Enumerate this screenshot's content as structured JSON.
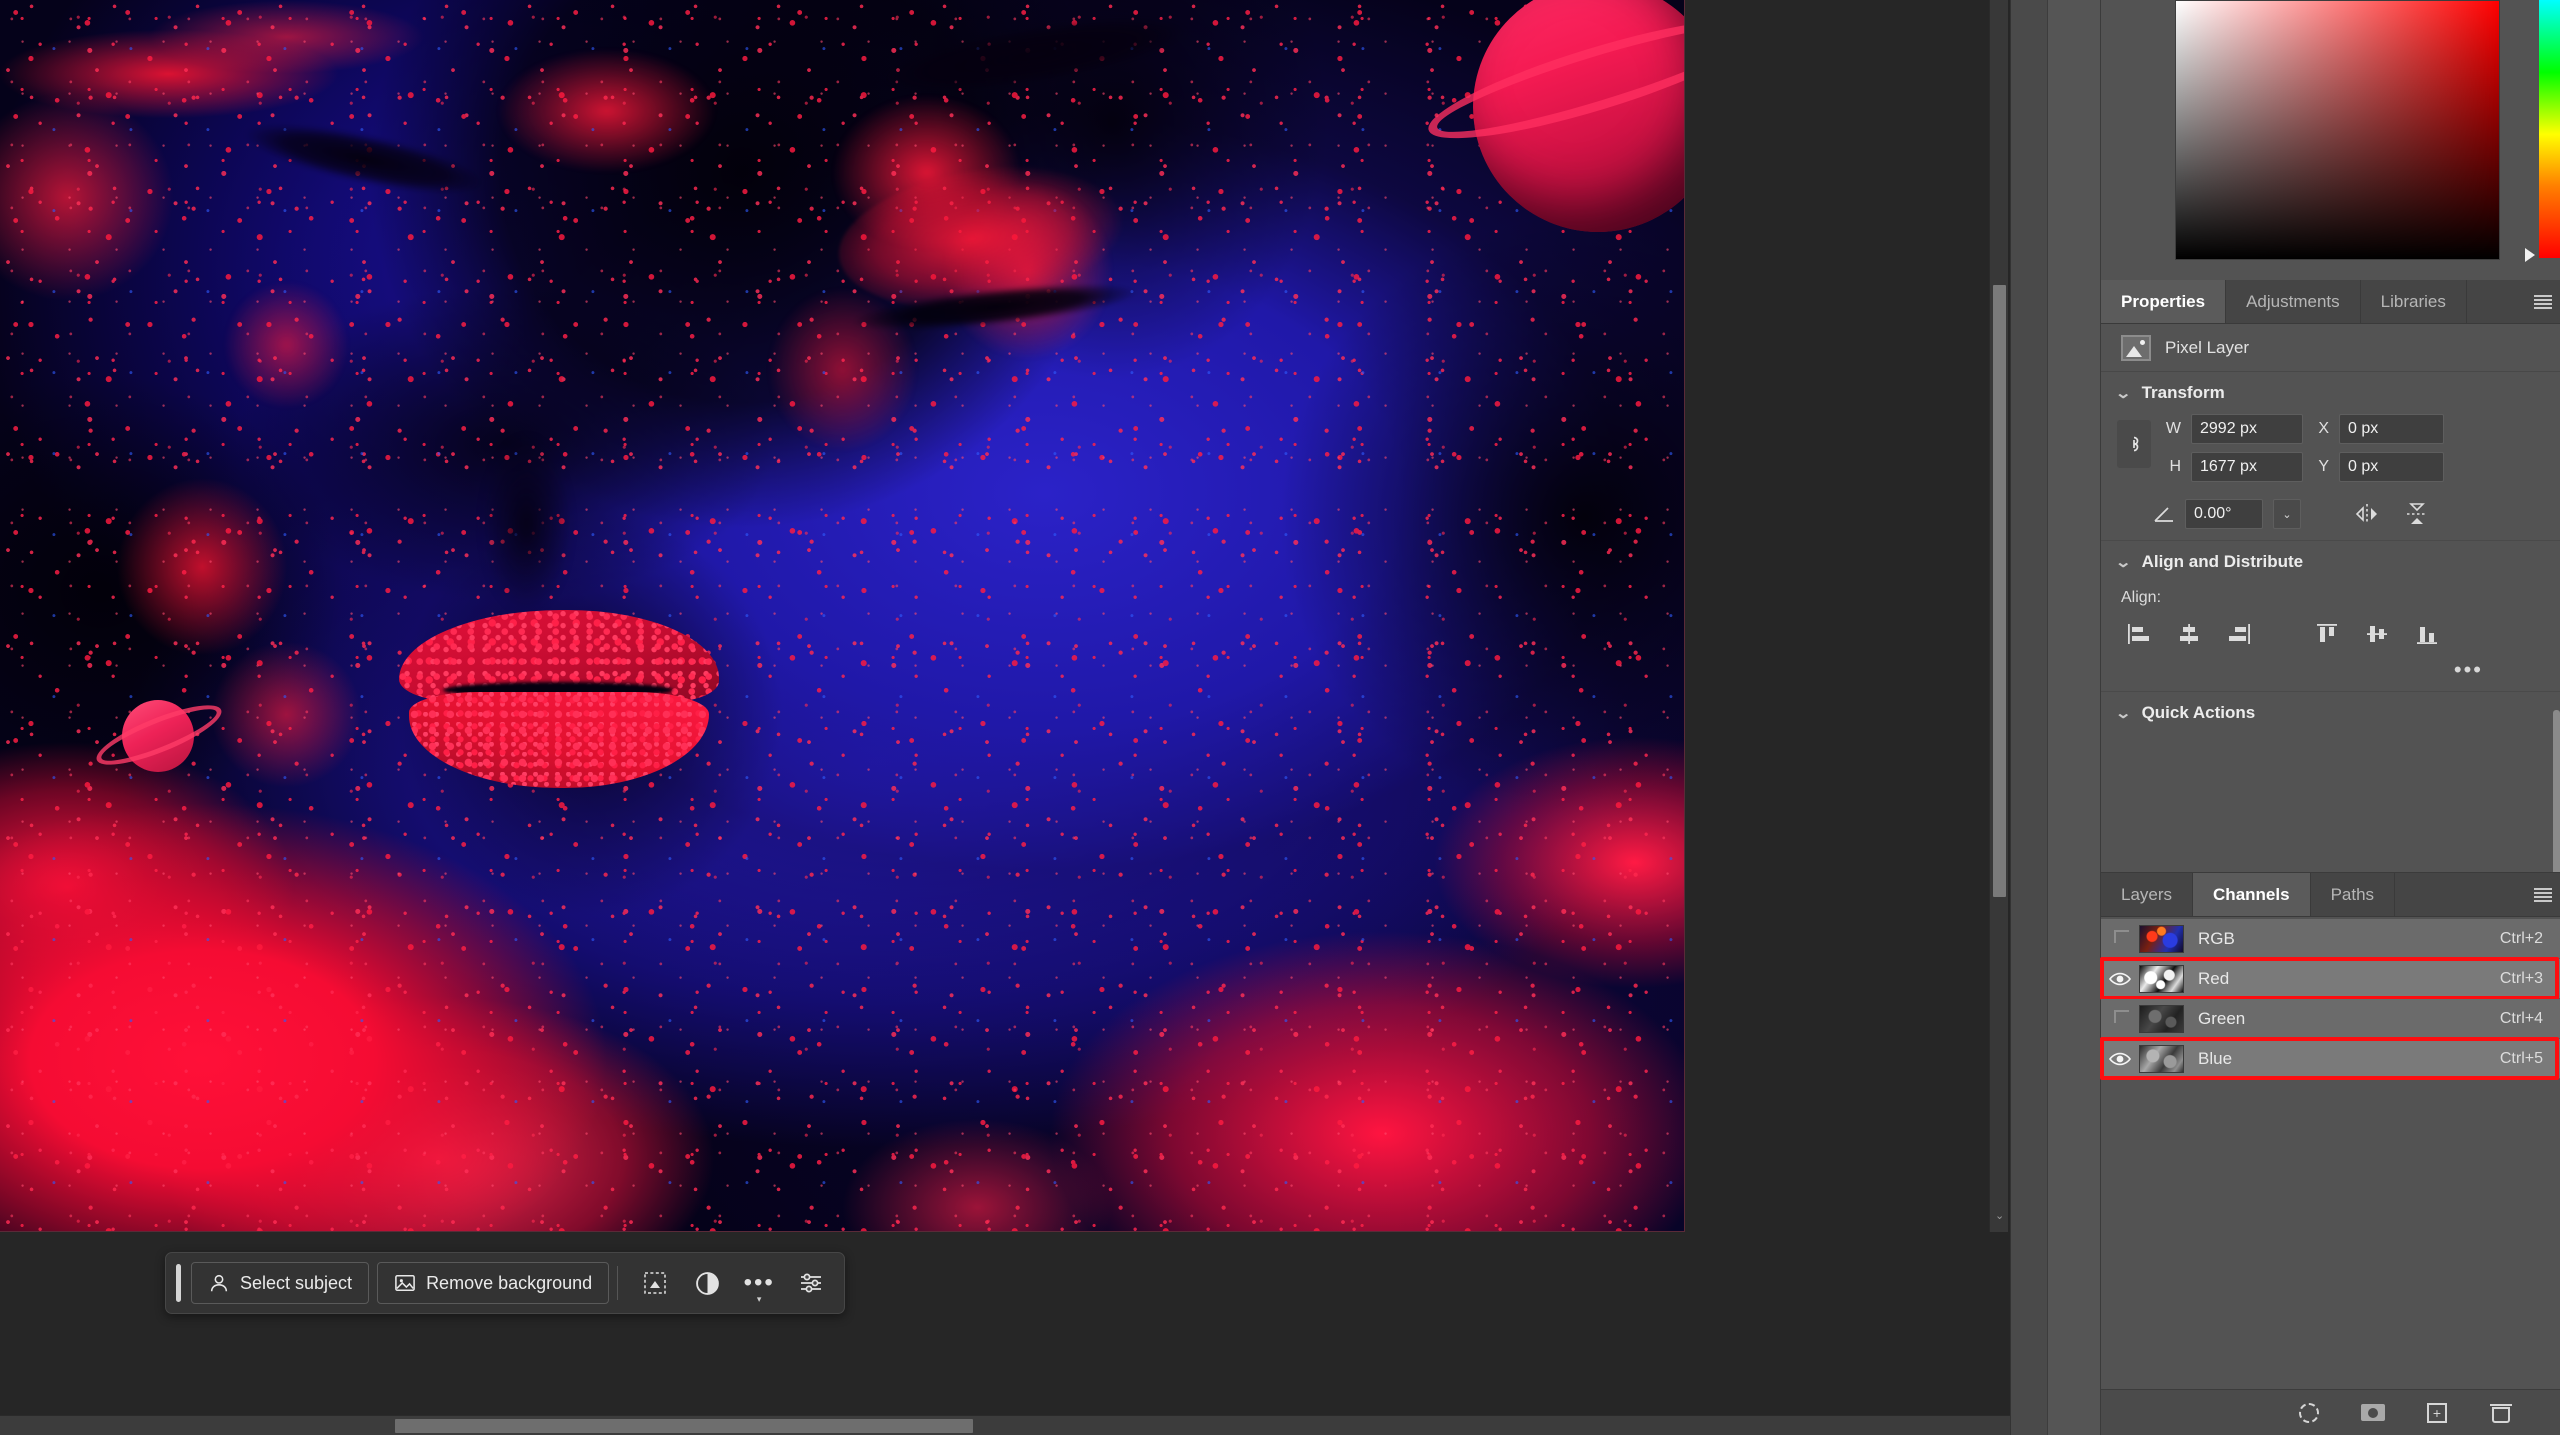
{
  "app": {
    "canvas_artwork_description": "Neon UV body paint portrait: blue face with red speckles, closed eye with lashes, red dotted lips, ringed planets, red nebula flames"
  },
  "color_picker": {
    "name": "color-picker",
    "square_gradient": [
      "#ffffff",
      "#ff0000",
      "#000000"
    ],
    "hue_stops": [
      "#00ffff",
      "#00ff00",
      "#ffff00",
      "#ff8000",
      "#ff0000"
    ]
  },
  "properties_panel": {
    "tabs": [
      {
        "label": "Properties",
        "active": true
      },
      {
        "label": "Adjustments",
        "active": false
      },
      {
        "label": "Libraries",
        "active": false
      }
    ],
    "layer_type": "Pixel Layer",
    "transform": {
      "title": "Transform",
      "w_label": "W",
      "w_value": "2992 px",
      "h_label": "H",
      "h_value": "1677 px",
      "x_label": "X",
      "x_value": "0 px",
      "y_label": "Y",
      "y_value": "0 px",
      "rotation_value": "0.00°",
      "flip_horizontal_icon": "flip-horizontal-icon",
      "flip_vertical_icon": "flip-vertical-icon",
      "link_icon": "link-chain-icon"
    },
    "align_and_distribute": {
      "title": "Align and Distribute",
      "align_label": "Align:",
      "buttons": [
        "align-left-edges",
        "align-horizontal-centers",
        "align-right-edges",
        "align-top-edges",
        "align-vertical-centers",
        "align-bottom-edges"
      ],
      "more_label": "•••"
    },
    "quick_actions": {
      "title": "Quick Actions"
    }
  },
  "channels_panel": {
    "tabs": [
      {
        "label": "Layers",
        "active": false
      },
      {
        "label": "Channels",
        "active": true
      },
      {
        "label": "Paths",
        "active": false
      }
    ],
    "rows": [
      {
        "name": "RGB",
        "shortcut": "Ctrl+2",
        "visible": false,
        "highlighted": false,
        "thumb": "th-rgb"
      },
      {
        "name": "Red",
        "shortcut": "Ctrl+3",
        "visible": true,
        "highlighted": true,
        "thumb": "th-red"
      },
      {
        "name": "Green",
        "shortcut": "Ctrl+4",
        "visible": false,
        "highlighted": false,
        "thumb": "th-green"
      },
      {
        "name": "Blue",
        "shortcut": "Ctrl+5",
        "visible": true,
        "highlighted": true,
        "thumb": "th-blue"
      }
    ],
    "highlight_color": "#fd0d10",
    "footer_buttons": [
      "load-channel-as-selection-icon",
      "save-selection-as-channel-icon",
      "create-new-channel-icon",
      "delete-channel-icon"
    ]
  },
  "contextual_taskbar": {
    "select_subject_label": "Select subject",
    "remove_background_label": "Remove background",
    "transform_selection_icon": "transform-selection-icon",
    "adjustment_icon": "adjustment-half-circle-icon",
    "more_options_label": "•••",
    "settings_icon": "settings-sliders-icon"
  }
}
